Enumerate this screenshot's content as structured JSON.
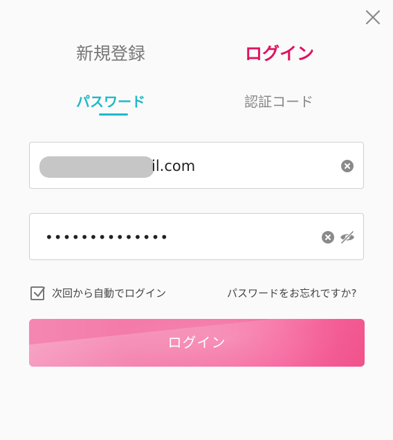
{
  "tabs": {
    "register": "新規登録",
    "login": "ログイン"
  },
  "sub_tabs": {
    "password": "パスワード",
    "code": "認証コード"
  },
  "form": {
    "email_visible_part": "il.com",
    "password_masked": "••••••••••••••"
  },
  "remember_label": "次回から自動でログイン",
  "remember_checked": true,
  "forgot_label": "パスワードをお忘れですか?",
  "login_button": "ログイン",
  "colors": {
    "accent": "#e0125f",
    "tab_active": "#1fb8c8",
    "button": "#f373a4"
  },
  "icons": [
    "close-icon",
    "clear-icon",
    "eye-off-icon",
    "checkbox-icon"
  ]
}
